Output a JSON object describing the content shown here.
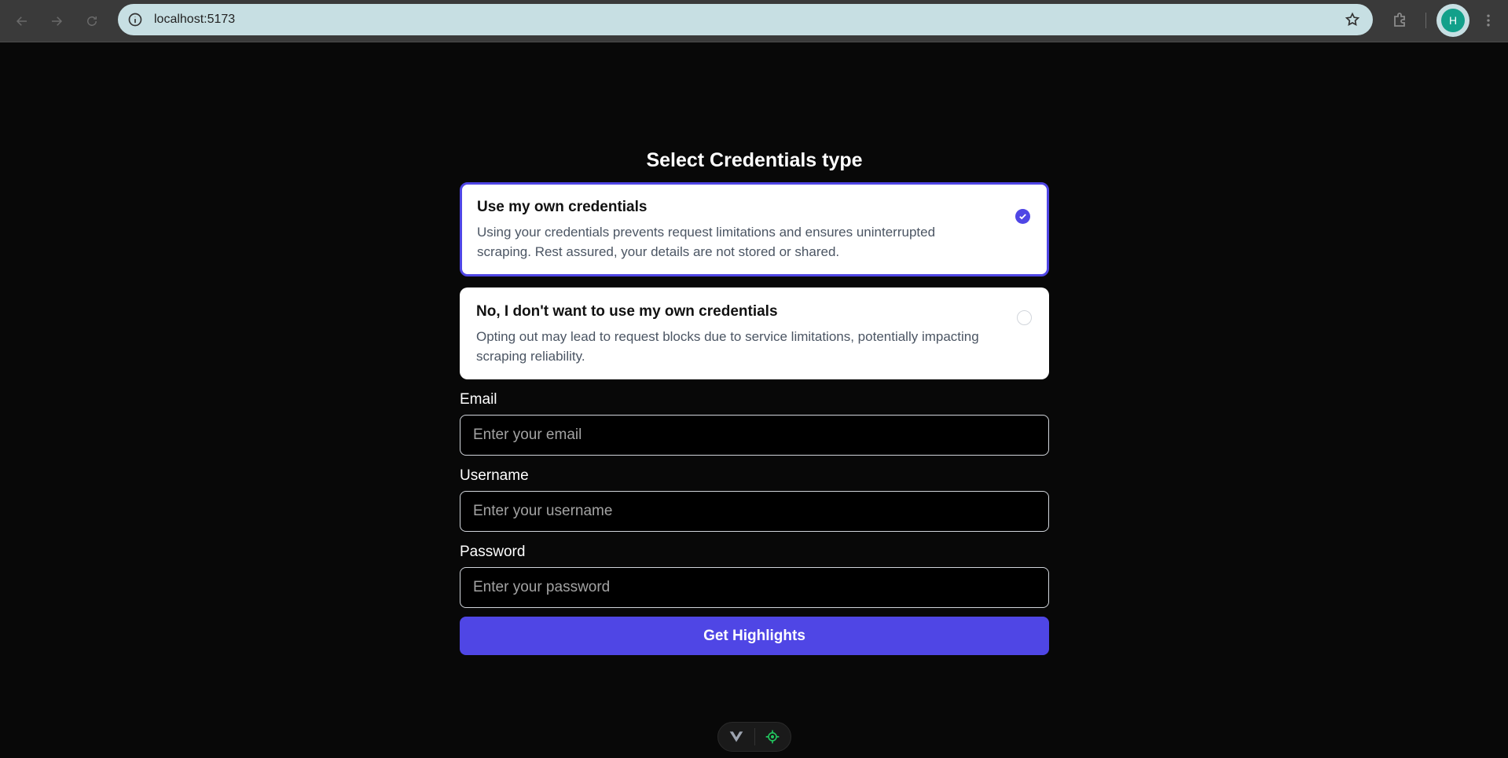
{
  "browser": {
    "url": "localhost:5173",
    "profile_initial": "H",
    "icons": {
      "back": "arrow-left-icon",
      "forward": "arrow-right-icon",
      "reload": "reload-icon",
      "site_info": "info-icon",
      "bookmark": "star-icon",
      "extensions": "puzzle-icon",
      "menu": "kebab-menu-icon"
    }
  },
  "page": {
    "title": "Select Credentials type",
    "options": [
      {
        "title": "Use my own credentials",
        "description": "Using your credentials prevents request limitations and ensures uninterrupted scraping. Rest assured, your details are not stored or shared.",
        "selected": true
      },
      {
        "title": "No, I don't want to use my own credentials",
        "description": "Opting out may lead to request blocks due to service limitations, potentially impacting scraping reliability.",
        "selected": false
      }
    ],
    "form": {
      "email_label": "Email",
      "email_placeholder": "Enter your email",
      "email_value": "",
      "username_label": "Username",
      "username_placeholder": "Enter your username",
      "username_value": "",
      "password_label": "Password",
      "password_placeholder": "Enter your password",
      "password_value": "",
      "submit_label": "Get Highlights"
    }
  },
  "colors": {
    "accent": "#4f46e5",
    "background": "#080808",
    "devtools_green": "#22c55e"
  }
}
